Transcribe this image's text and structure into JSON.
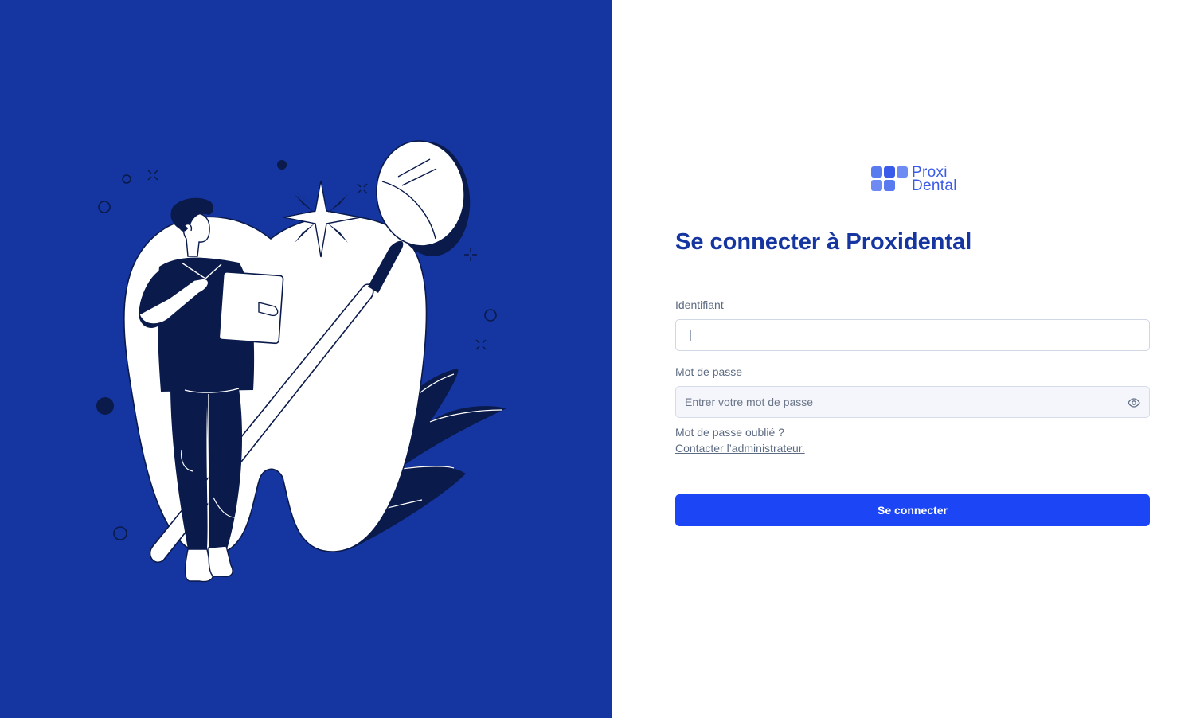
{
  "brand": {
    "logo_line1": "Proxi",
    "logo_line2": "Dental",
    "logo_color": "#3a5bea"
  },
  "left_panel": {
    "background_color": "#1535a0",
    "illustration": "dentist-with-tooth-and-mirror-illustration"
  },
  "login": {
    "title": "Se connecter à Proxidental",
    "title_color": "#1535a0",
    "identifier": {
      "label": "Identifiant",
      "value": "",
      "placeholder": ""
    },
    "password": {
      "label": "Mot de passe",
      "value": "",
      "placeholder": "Entrer votre mot de passe",
      "toggle_icon": "eye-icon"
    },
    "forgot_text": "Mot de passe oublié ?",
    "contact_link": "Contacter l’administrateur.",
    "submit_label": "Se connecter",
    "submit_color": "#1b45f5"
  }
}
